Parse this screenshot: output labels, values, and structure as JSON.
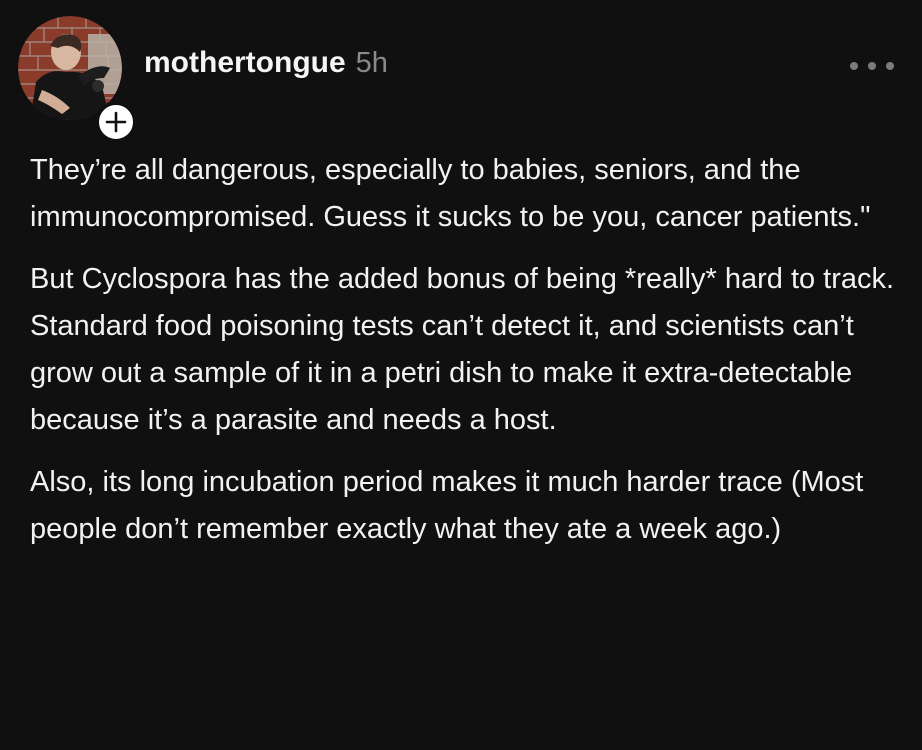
{
  "post": {
    "username": "mothertongue",
    "timestamp": "5h",
    "follow_icon": "plus-icon",
    "more_icon": "more-horizontal-icon",
    "paragraphs": [
      "They’re all dangerous, especially to babies, seniors, and the immunocompromised. Guess it sucks to be you, cancer patients.\"",
      "But Cyclospora has the added bonus of being *really* hard to track. Standard food poisoning tests can’t detect it, and scientists can’t grow out a sample of it in a petri dish to make it extra-detectable because it’s a parasite and needs a host.",
      "Also, its long incubation period makes it much harder trace (Most people don’t remember exactly what they ate a week ago.)"
    ]
  },
  "colors": {
    "background": "#101010",
    "text": "#f2f2f2",
    "muted": "#8a8a8a"
  }
}
